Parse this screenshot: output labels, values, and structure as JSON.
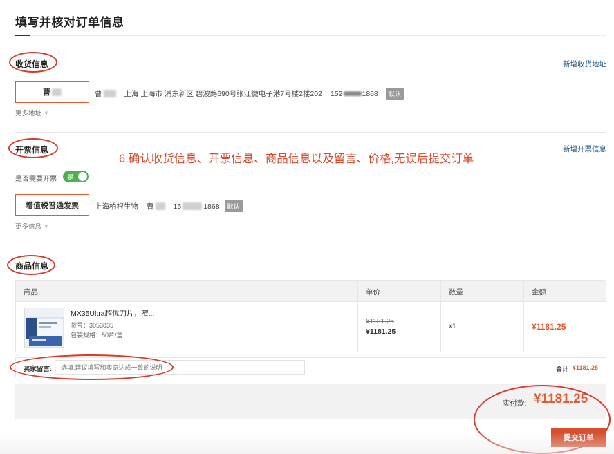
{
  "page": {
    "title": "填写并核对订单信息"
  },
  "instruction": "6.确认收货信息、开票信息、商品信息以及留言、价格,无误后提交订单",
  "shipping": {
    "section_title": "收货信息",
    "add_link": "新增收货地址",
    "recipient_surname": "曹",
    "name_prefix": "曹",
    "address": "上海 上海市 浦东新区 碧波路690号张江微电子港7号楼2楼202",
    "phone_prefix": "152",
    "phone_suffix": "1868",
    "default_badge": "默认",
    "more_label": "更多地址"
  },
  "invoice": {
    "section_title": "开票信息",
    "add_link": "新增开票信息",
    "need_label": "是否需要开票",
    "toggle_label": "是",
    "type_label": "增值税普通发票",
    "company": "上海柏根生物",
    "contact_prefix": "曹",
    "phone_prefix": "15",
    "phone_suffix": "1868",
    "default_badge": "默认",
    "more_label": "更多信息"
  },
  "products": {
    "section_title": "商品信息",
    "columns": [
      "商品",
      "单价",
      "数量",
      "金额"
    ],
    "items": [
      {
        "name": "MX35Ultra超优刀片，窄...",
        "sku": "货号：3053835",
        "spec": "包装规格：50片/盒",
        "original_price": "¥1181.25",
        "price": "¥1181.25",
        "qty": "x1",
        "amount": "¥1181.25"
      }
    ]
  },
  "message": {
    "label": "买家留言:",
    "placeholder": "选填,建议填写和卖家达成一致的说明",
    "total_label": "合计",
    "total_value": "¥1181.25"
  },
  "payment": {
    "label": "实付款:",
    "amount": "¥1181.25",
    "submit_label": "提交订单"
  },
  "colors": {
    "accent": "#e2582f",
    "annotation": "#d53a2a",
    "toggle_on": "#4caf50",
    "link": "#2b5d8c"
  }
}
